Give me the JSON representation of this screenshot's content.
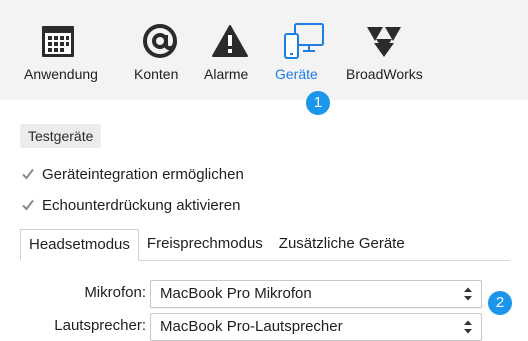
{
  "toolbar": {
    "items": [
      {
        "label": "Anwendung",
        "icon": "calendar-icon"
      },
      {
        "label": "Konten",
        "icon": "at-icon"
      },
      {
        "label": "Alarme",
        "icon": "warning-icon"
      },
      {
        "label": "Geräte",
        "icon": "devices-icon",
        "active": true
      },
      {
        "label": "BroadWorks",
        "icon": "broadworks-logo-icon"
      }
    ]
  },
  "badges": {
    "one": "1",
    "two": "2"
  },
  "section": {
    "title": "Testgeräte"
  },
  "options": [
    {
      "label": "Geräteintegration ermöglichen",
      "checked": true
    },
    {
      "label": "Echounterdrückung aktivieren",
      "checked": true
    }
  ],
  "tabs": [
    {
      "label": "Headsetmodus",
      "active": true
    },
    {
      "label": "Freisprechmodus",
      "active": false
    },
    {
      "label": "Zusätzliche Geräte",
      "active": false
    }
  ],
  "form": {
    "mic": {
      "label": "Mikrofon:",
      "value": "MacBook Pro Mikrofon"
    },
    "speaker": {
      "label": "Lautsprecher:",
      "value": "MacBook Pro-Lautsprecher"
    }
  },
  "colors": {
    "accent": "#1e7fe0",
    "badge": "#1b96ea",
    "toolbar_bg": "#f3f3f3"
  }
}
